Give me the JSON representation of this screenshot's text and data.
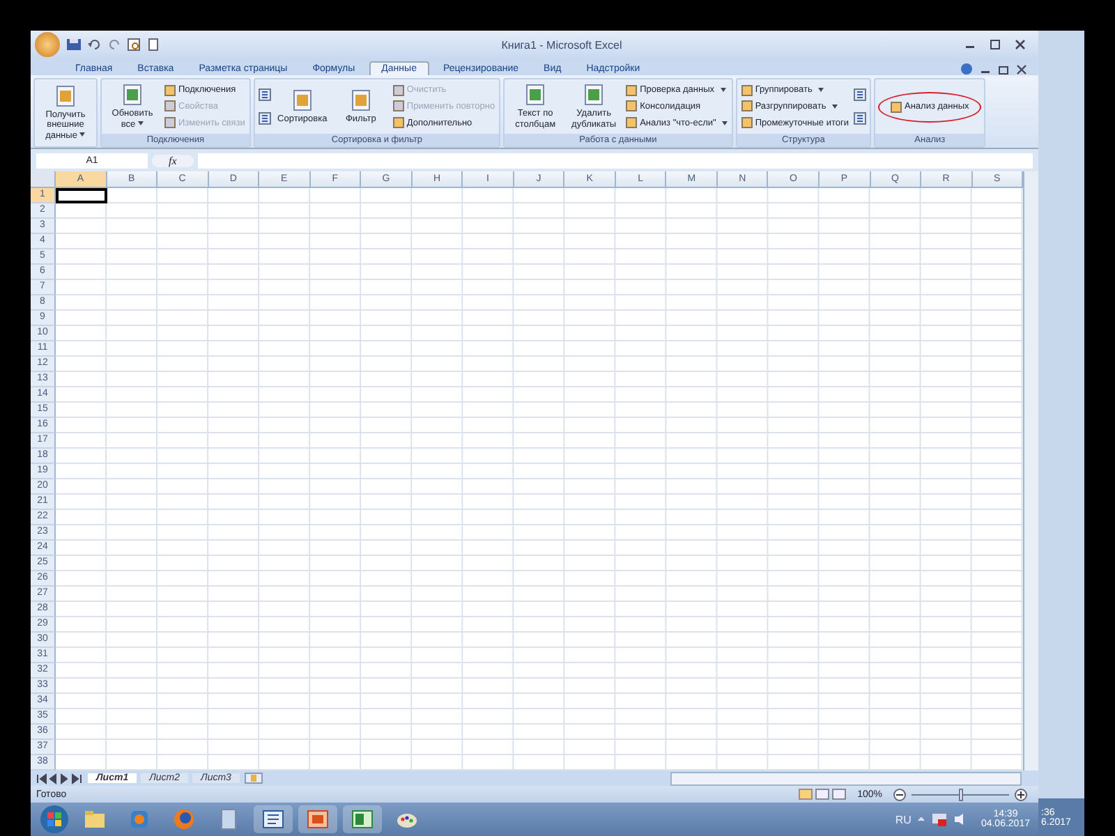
{
  "window": {
    "title": "Книга1 - Microsoft Excel"
  },
  "tabs": [
    {
      "label": "Главная",
      "selected": false
    },
    {
      "label": "Вставка",
      "selected": false
    },
    {
      "label": "Разметка страницы",
      "selected": false
    },
    {
      "label": "Формулы",
      "selected": false
    },
    {
      "label": "Данные",
      "selected": true
    },
    {
      "label": "Рецензирование",
      "selected": false
    },
    {
      "label": "Вид",
      "selected": false
    },
    {
      "label": "Надстройки",
      "selected": false
    }
  ],
  "ribbon_groups": [
    {
      "columns": [
        [
          {
            "kind": "large",
            "label": "Получить внешние данные",
            "dropdown": true
          }
        ]
      ]
    },
    {
      "label": "Подключения",
      "columns": [
        [
          {
            "kind": "large",
            "label": "Обновить все",
            "dropdown": true
          }
        ],
        [
          {
            "kind": "small",
            "label": "Подключения"
          },
          {
            "kind": "small",
            "label": "Свойства",
            "disabled": true
          },
          {
            "kind": "small",
            "label": "Изменить связи",
            "disabled": true
          }
        ]
      ]
    },
    {
      "label": "Сортировка и фильтр",
      "columns": [
        [
          {
            "kind": "icon"
          },
          {
            "kind": "icon"
          }
        ],
        [
          {
            "kind": "large",
            "label": "Сортировка"
          }
        ],
        [
          {
            "kind": "large",
            "label": "Фильтр"
          }
        ],
        [
          {
            "kind": "small",
            "label": "Очистить",
            "disabled": true
          },
          {
            "kind": "small",
            "label": "Применить повторно",
            "disabled": true
          },
          {
            "kind": "small",
            "label": "Дополнительно"
          }
        ]
      ]
    },
    {
      "label": "Работа с данными",
      "columns": [
        [
          {
            "kind": "large",
            "label": "Текст по столбцам"
          }
        ],
        [
          {
            "kind": "large",
            "label": "Удалить дубликаты"
          }
        ],
        [
          {
            "kind": "small",
            "label": "Проверка данных",
            "dropdown": true
          },
          {
            "kind": "small",
            "label": "Консолидация"
          },
          {
            "kind": "small",
            "label": "Анализ \"что-если\"",
            "dropdown": true
          }
        ]
      ]
    },
    {
      "label": "Структура",
      "columns": [
        [
          {
            "kind": "small",
            "label": "Группировать",
            "dropdown": true
          },
          {
            "kind": "small",
            "label": "Разгруппировать",
            "dropdown": true
          },
          {
            "kind": "small",
            "label": "Промежуточные итоги"
          }
        ],
        [
          {
            "kind": "icon"
          },
          {
            "kind": "icon"
          }
        ]
      ]
    },
    {
      "label": "Анализ",
      "columns": [
        [
          {
            "kind": "small",
            "label": "Анализ данных",
            "circled": true
          }
        ]
      ]
    }
  ],
  "formula_bar": {
    "name_box": "A1",
    "function_label": "fx"
  },
  "columns": [
    {
      "label": "A",
      "selected": true
    },
    {
      "label": "B",
      "selected": false
    },
    {
      "label": "C",
      "selected": false
    },
    {
      "label": "D",
      "selected": false
    },
    {
      "label": "E",
      "selected": false
    },
    {
      "label": "F",
      "selected": false
    },
    {
      "label": "G",
      "selected": false
    },
    {
      "label": "H",
      "selected": false
    },
    {
      "label": "I",
      "selected": false
    },
    {
      "label": "J",
      "selected": false
    },
    {
      "label": "K",
      "selected": false
    },
    {
      "label": "L",
      "selected": false
    },
    {
      "label": "M",
      "selected": false
    },
    {
      "label": "N",
      "selected": false
    },
    {
      "label": "O",
      "selected": false
    },
    {
      "label": "P",
      "selected": false
    },
    {
      "label": "Q",
      "selected": false
    },
    {
      "label": "R",
      "selected": false
    },
    {
      "label": "S",
      "selected": false
    }
  ],
  "rows": [
    {
      "label": "1",
      "selected": true
    },
    {
      "label": "2",
      "selected": false
    },
    {
      "label": "3",
      "selected": false
    },
    {
      "label": "4",
      "selected": false
    },
    {
      "label": "5",
      "selected": false
    },
    {
      "label": "6",
      "selected": false
    },
    {
      "label": "7",
      "selected": false
    },
    {
      "label": "8",
      "selected": false
    },
    {
      "label": "9",
      "selected": false
    },
    {
      "label": "10",
      "selected": false
    },
    {
      "label": "11",
      "selected": false
    },
    {
      "label": "12",
      "selected": false
    },
    {
      "label": "13",
      "selected": false
    },
    {
      "label": "14",
      "selected": false
    },
    {
      "label": "15",
      "selected": false
    },
    {
      "label": "16",
      "selected": false
    },
    {
      "label": "17",
      "selected": false
    },
    {
      "label": "18",
      "selected": false
    },
    {
      "label": "19",
      "selected": false
    },
    {
      "label": "20",
      "selected": false
    },
    {
      "label": "21",
      "selected": false
    },
    {
      "label": "22",
      "selected": false
    },
    {
      "label": "23",
      "selected": false
    },
    {
      "label": "24",
      "selected": false
    },
    {
      "label": "25",
      "selected": false
    },
    {
      "label": "26",
      "selected": false
    },
    {
      "label": "27",
      "selected": false
    },
    {
      "label": "28",
      "selected": false
    },
    {
      "label": "29",
      "selected": false
    },
    {
      "label": "30",
      "selected": false
    },
    {
      "label": "31",
      "selected": false
    },
    {
      "label": "32",
      "selected": false
    },
    {
      "label": "33",
      "selected": false
    },
    {
      "label": "34",
      "selected": false
    },
    {
      "label": "35",
      "selected": false
    },
    {
      "label": "36",
      "selected": false
    },
    {
      "label": "37",
      "selected": false
    },
    {
      "label": "38",
      "selected": false
    }
  ],
  "sheet_tabs": [
    {
      "label": "Лист1",
      "selected": true
    },
    {
      "label": "Лист2",
      "selected": false
    },
    {
      "label": "Лист3",
      "selected": false
    }
  ],
  "status_bar": {
    "text": "Готово",
    "zoom": "100%",
    "zoom_slider": {
      "level": 0.5
    }
  },
  "taskbar": {
    "language": "RU",
    "time": "14:39",
    "date": "04.06.2017"
  },
  "background_window": {
    "time": ":36",
    "date": "6.2017"
  }
}
